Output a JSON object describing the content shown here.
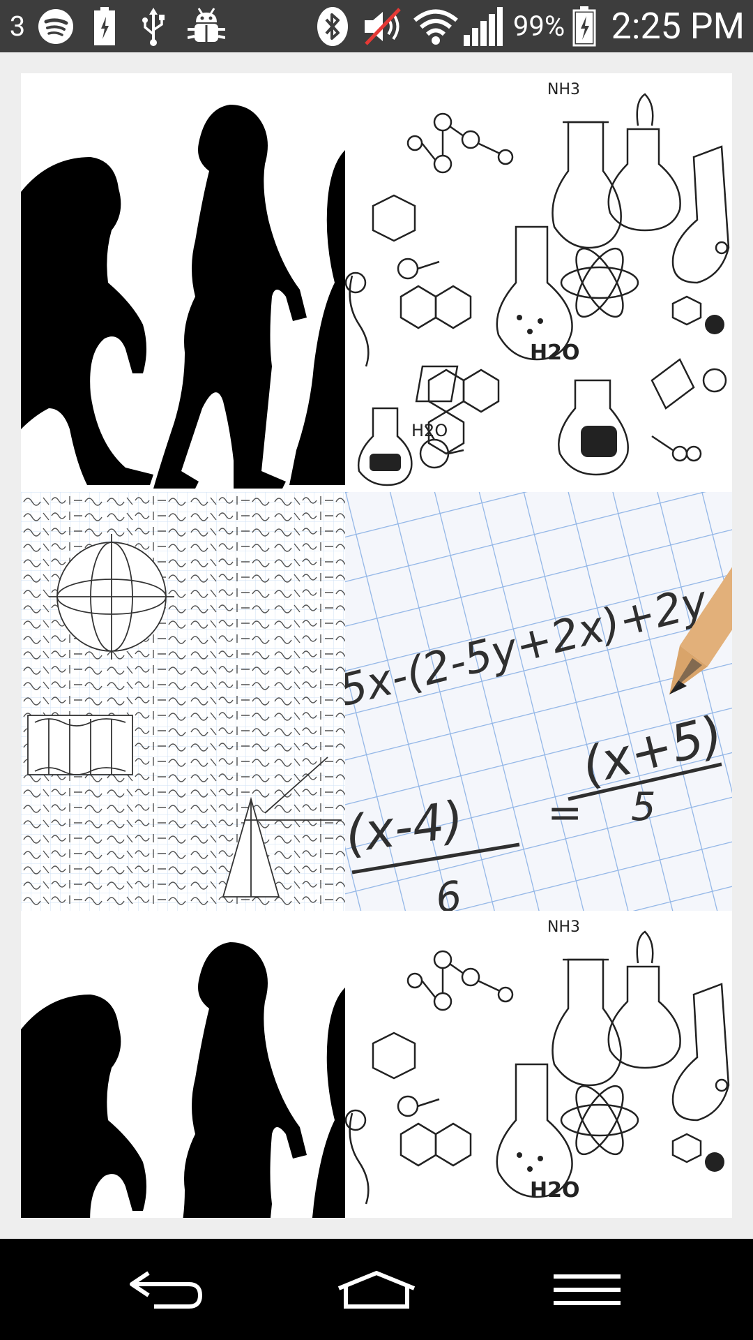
{
  "status_bar": {
    "notification_count": "3",
    "battery_percent": "99%",
    "time": "2:25 PM",
    "icons": [
      "spotify-icon",
      "battery-charging-small-icon",
      "usb-icon",
      "android-debug-icon",
      "bluetooth-icon",
      "volume-muted-icon",
      "wifi-icon",
      "signal-icon",
      "battery-charging-icon"
    ]
  },
  "gallery": {
    "tiles": [
      {
        "subject": "human evolution silhouettes"
      },
      {
        "subject": "chemistry doodles",
        "label_h2o": "H2O",
        "label_nh3": "NH3"
      },
      {
        "subject": "math formulas sketch"
      },
      {
        "subject": "algebra on grid paper with pencil",
        "formula_top": "5x-(2-5y+2x)+2y",
        "formula_lhs": "(x-4)",
        "formula_lhs_den": "6",
        "formula_eq": "=",
        "formula_rhs": "(x+5)",
        "formula_rhs_den": "5"
      },
      {
        "subject": "human evolution silhouettes"
      },
      {
        "subject": "chemistry doodles",
        "label_h2o": "H2O",
        "label_nh3": "NH3"
      }
    ]
  },
  "nav_bar": {
    "icons": [
      "back-icon",
      "home-icon",
      "menu-icon"
    ]
  },
  "colors": {
    "status_bg": "#3d3d3d",
    "page_bg": "#eeeeee",
    "nav_bg": "#000000",
    "grid_blue": "#8fb4e6"
  }
}
